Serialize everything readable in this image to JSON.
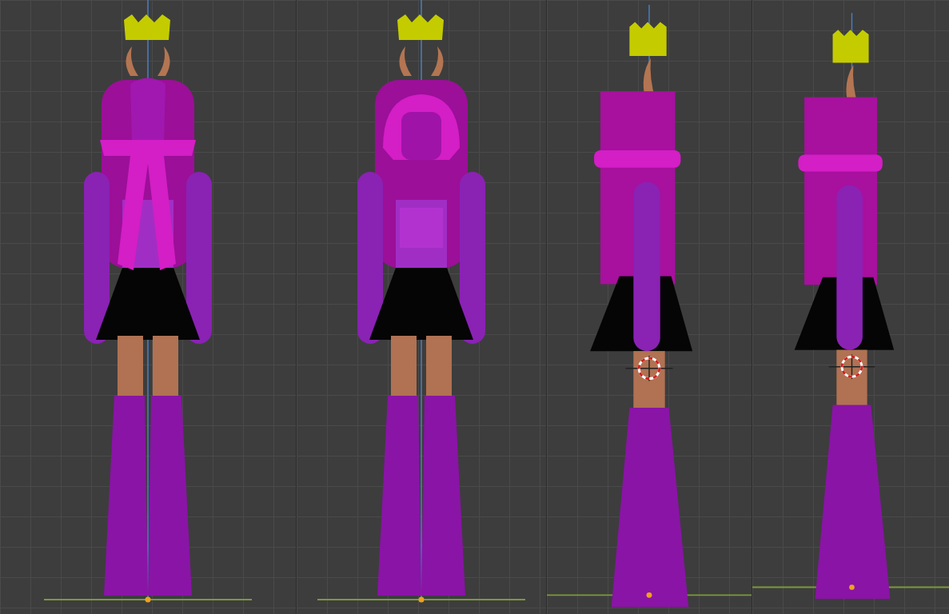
{
  "viewports": [
    {
      "kind": "back",
      "cursor": false
    },
    {
      "kind": "front",
      "cursor": false
    },
    {
      "kind": "side",
      "cursor": true
    },
    {
      "kind": "side",
      "cursor": true
    }
  ]
}
